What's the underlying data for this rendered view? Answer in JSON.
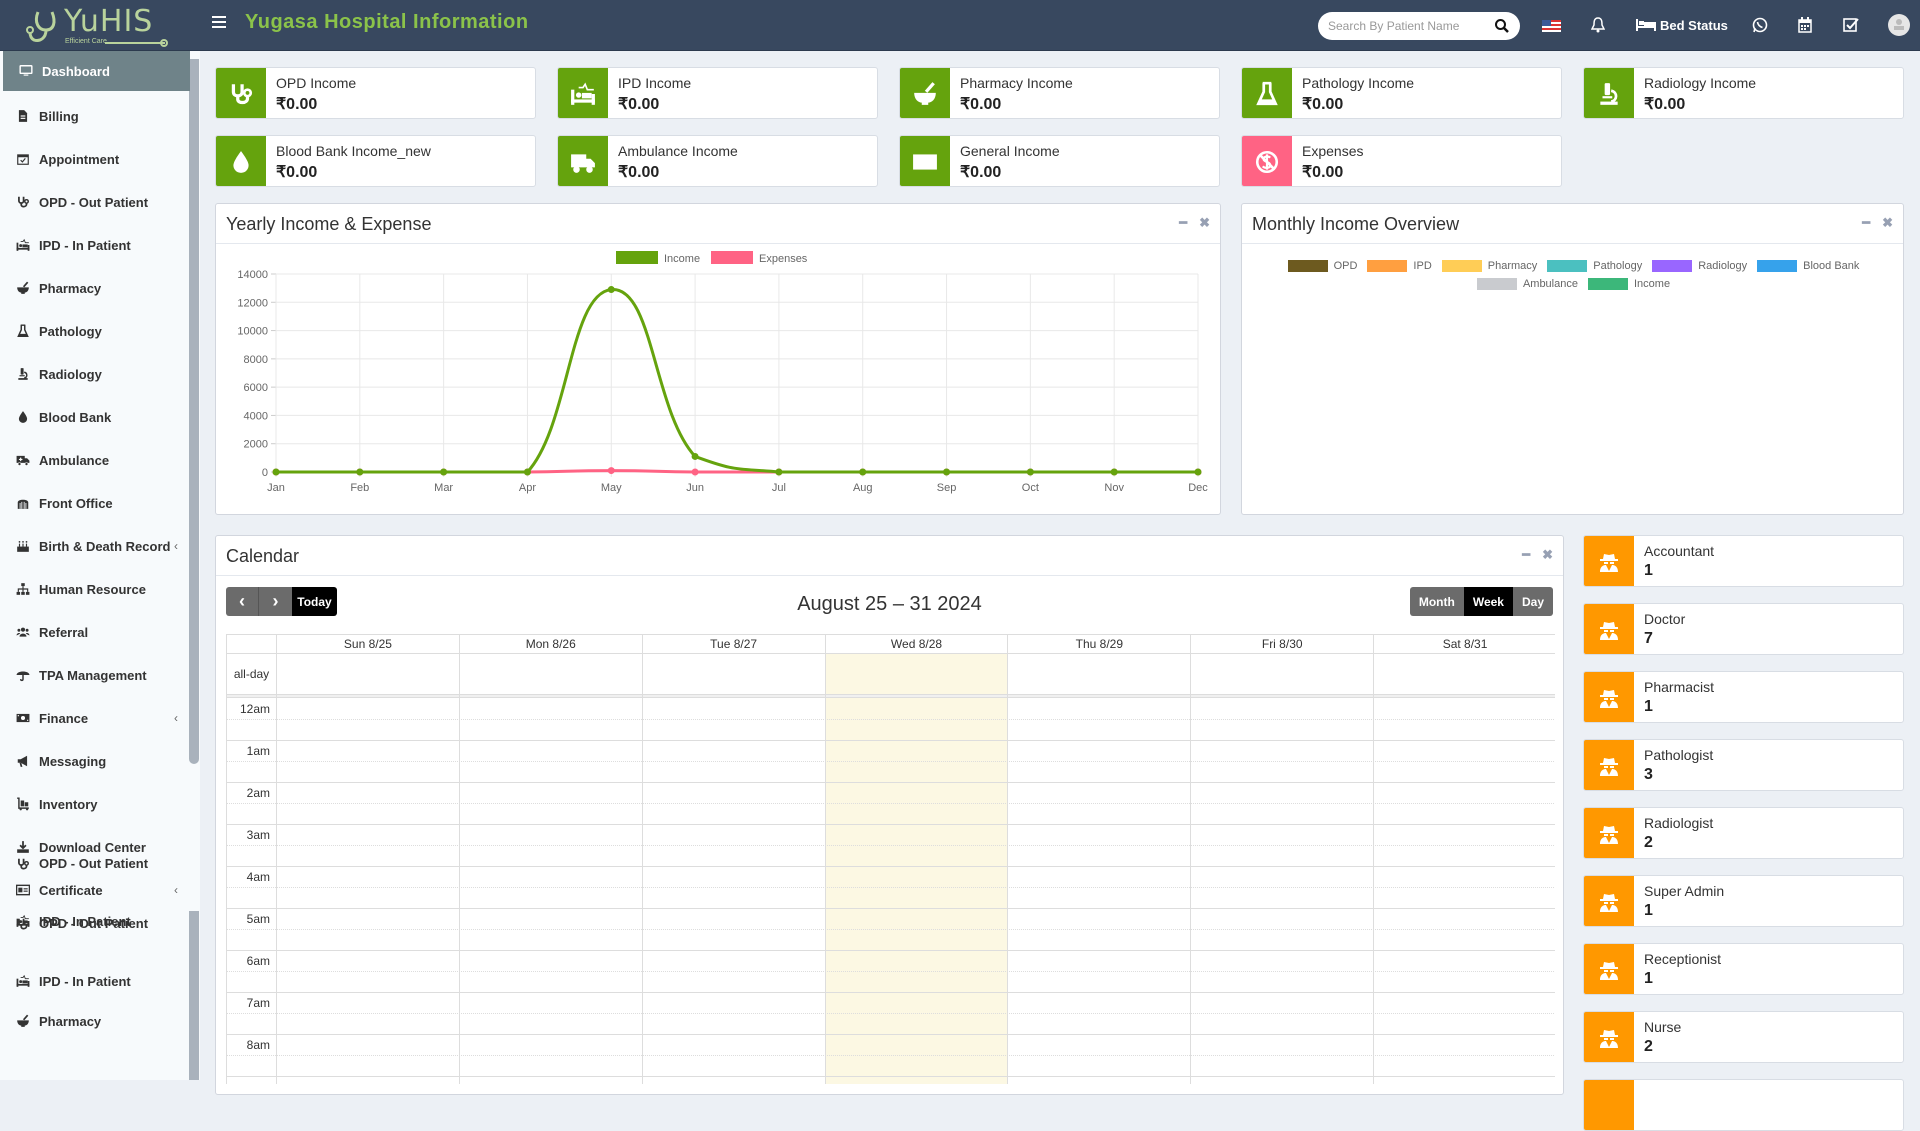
{
  "header": {
    "logo_text": "YuHIS",
    "logo_tagline": "Efficient Care",
    "title": "Yugasa Hospital Information",
    "search_placeholder": "Search By Patient Name",
    "bed_status_label": "Bed Status"
  },
  "sidebar": {
    "items": [
      {
        "label": "Dashboard",
        "icon": "monitor-icon",
        "active": true
      },
      {
        "label": "Billing",
        "icon": "file-invoice-icon"
      },
      {
        "label": "Appointment",
        "icon": "calendar-check-icon"
      },
      {
        "label": "OPD - Out Patient",
        "icon": "stethoscope-icon"
      },
      {
        "label": "IPD - In Patient",
        "icon": "procedures-bed-icon"
      },
      {
        "label": "Pharmacy",
        "icon": "mortar-pestle-icon"
      },
      {
        "label": "Pathology",
        "icon": "flask-icon"
      },
      {
        "label": "Radiology",
        "icon": "microscope-icon"
      },
      {
        "label": "Blood Bank",
        "icon": "tint-drop-icon"
      },
      {
        "label": "Ambulance",
        "icon": "ambulance-icon"
      },
      {
        "label": "Front Office",
        "icon": "dungeon-icon"
      },
      {
        "label": "Birth & Death Record",
        "icon": "birthday-cake-icon",
        "caret": "‹"
      },
      {
        "label": "Human Resource",
        "icon": "sitemap-icon"
      },
      {
        "label": "Referral",
        "icon": "users-icon"
      },
      {
        "label": "TPA Management",
        "icon": "umbrella-icon"
      },
      {
        "label": "Finance",
        "icon": "money-bill-icon",
        "caret": "‹"
      },
      {
        "label": "Messaging",
        "icon": "bullhorn-icon"
      },
      {
        "label": "Inventory",
        "icon": "luggage-cart-icon"
      },
      {
        "label": "Download Center",
        "icon": "download-icon"
      },
      {
        "label": "Certificate",
        "icon": "id-card-icon",
        "caret": "‹"
      }
    ],
    "overflow_items": [
      {
        "label": "OPD - Out Patient",
        "icon": "stethoscope-icon"
      },
      {
        "label": "IPD - In Patient",
        "icon": "procedures-bed-icon"
      },
      {
        "label": "OPD - Out Patient",
        "icon": "stethoscope-icon"
      },
      {
        "label": "IPD - In Patient",
        "icon": "procedures-bed-icon"
      },
      {
        "label": "Pharmacy",
        "icon": "mortar-pestle-icon"
      }
    ]
  },
  "income_boxes": [
    {
      "label": "OPD Income",
      "value": "₹0.00",
      "icon": "stethoscope-icon"
    },
    {
      "label": "IPD Income",
      "value": "₹0.00",
      "icon": "procedures-bed-icon"
    },
    {
      "label": "Pharmacy Income",
      "value": "₹0.00",
      "icon": "mortar-pestle-icon"
    },
    {
      "label": "Pathology Income",
      "value": "₹0.00",
      "icon": "flask-icon"
    },
    {
      "label": "Radiology Income",
      "value": "₹0.00",
      "icon": "microscope-icon"
    },
    {
      "label": "Blood Bank Income_new",
      "value": "₹0.00",
      "icon": "tint-drop-icon"
    },
    {
      "label": "Ambulance Income",
      "value": "₹0.00",
      "icon": "ambulance-icon"
    },
    {
      "label": "General Income",
      "value": "₹0.00",
      "icon": "money-bill-icon"
    },
    {
      "label": "Expenses",
      "value": "₹0.00",
      "icon": "expense-icon",
      "color": "#ff6384"
    }
  ],
  "yearly_panel": {
    "title": "Yearly Income & Expense"
  },
  "monthly_panel": {
    "title": "Monthly Income Overview",
    "legend": [
      {
        "label": "OPD",
        "color": "#6d5a1f"
      },
      {
        "label": "IPD",
        "color": "#ff9f40"
      },
      {
        "label": "Pharmacy",
        "color": "#ffcd56"
      },
      {
        "label": "Pathology",
        "color": "#4bc0c0"
      },
      {
        "label": "Radiology",
        "color": "#9966ff"
      },
      {
        "label": "Blood Bank",
        "color": "#36a2eb"
      },
      {
        "label": "Ambulance",
        "color": "#c9cbcf"
      },
      {
        "label": "Income",
        "color": "#3cb77a"
      }
    ]
  },
  "chart_data": {
    "type": "line",
    "title": "Yearly Income & Expense",
    "categories": [
      "Jan",
      "Feb",
      "Mar",
      "Apr",
      "May",
      "Jun",
      "Jul",
      "Aug",
      "Sep",
      "Oct",
      "Nov",
      "Dec"
    ],
    "series": [
      {
        "name": "Income",
        "color": "#65a30d",
        "values": [
          0,
          0,
          0,
          0,
          12900,
          1100,
          0,
          0,
          0,
          0,
          0,
          0
        ]
      },
      {
        "name": "Expenses",
        "color": "#ff6384",
        "values": [
          0,
          0,
          0,
          0,
          100,
          0,
          0,
          0,
          0,
          0,
          0,
          0
        ]
      }
    ],
    "ylim": [
      0,
      14000
    ],
    "yticks": [
      0,
      2000,
      4000,
      6000,
      8000,
      10000,
      12000,
      14000
    ],
    "xlabel": "",
    "ylabel": "",
    "grid": true,
    "legend_position": "top"
  },
  "calendar": {
    "title": "Calendar",
    "range_title": "August 25 – 31 2024",
    "today_label": "Today",
    "prev_label": "‹",
    "next_label": "›",
    "views": [
      "Month",
      "Week",
      "Day"
    ],
    "active_view": "Week",
    "days": [
      "Sun 8/25",
      "Mon 8/26",
      "Tue 8/27",
      "Wed 8/28",
      "Thu 8/29",
      "Fri 8/30",
      "Sat 8/31"
    ],
    "today_index": 3,
    "allday_label": "all-day",
    "hours": [
      "12am",
      "1am",
      "2am",
      "3am",
      "4am",
      "5am",
      "6am",
      "7am",
      "8am"
    ]
  },
  "staff": [
    {
      "role": "Accountant",
      "count": "1"
    },
    {
      "role": "Doctor",
      "count": "7"
    },
    {
      "role": "Pharmacist",
      "count": "1"
    },
    {
      "role": "Pathologist",
      "count": "3"
    },
    {
      "role": "Radiologist",
      "count": "2"
    },
    {
      "role": "Super Admin",
      "count": "1"
    },
    {
      "role": "Receptionist",
      "count": "1"
    },
    {
      "role": "Nurse",
      "count": "2"
    }
  ]
}
